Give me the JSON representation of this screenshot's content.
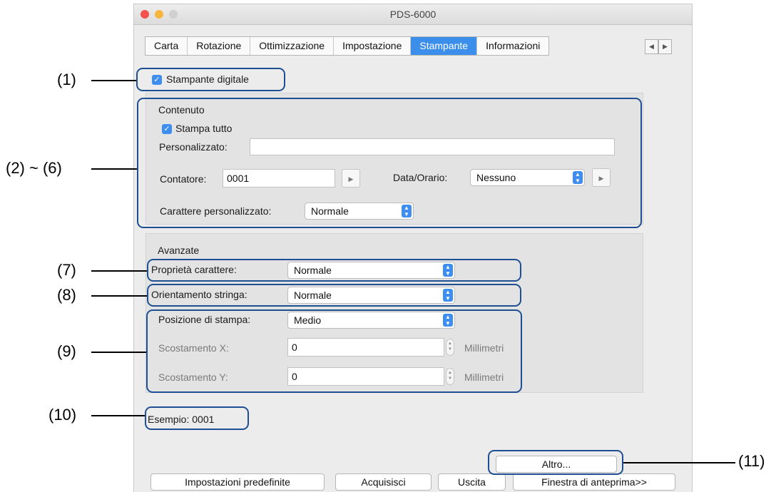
{
  "window": {
    "title": "PDS-6000"
  },
  "tabs": [
    {
      "label": "Carta",
      "active": false
    },
    {
      "label": "Rotazione",
      "active": false
    },
    {
      "label": "Ottimizzazione",
      "active": false
    },
    {
      "label": "Impostazione",
      "active": false
    },
    {
      "label": "Stampante",
      "active": true
    },
    {
      "label": "Informazioni",
      "active": false
    }
  ],
  "tab_arrows": {
    "left": "◀",
    "right": "▶"
  },
  "digital_printer": {
    "label": "Stampante digitale",
    "checked": true
  },
  "contenuto": {
    "heading": "Contenuto",
    "print_all": {
      "label": "Stampa tutto",
      "checked": true
    },
    "custom_label": "Personalizzato:",
    "custom_value": "",
    "counter_label": "Contatore:",
    "counter_value": "0001",
    "datetime_label": "Data/Orario:",
    "datetime_value": "Nessuno",
    "custom_char_label": "Carattere personalizzato:",
    "custom_char_value": "Normale"
  },
  "avanzate": {
    "heading": "Avanzate",
    "char_property_label": "Proprietà carattere:",
    "char_property_value": "Normale",
    "string_orientation_label": "Orientamento stringa:",
    "string_orientation_value": "Normale",
    "print_position_label": "Posizione di stampa:",
    "print_position_value": "Medio",
    "offset_x_label": "Scostamento X:",
    "offset_x_value": "0",
    "offset_y_label": "Scostamento Y:",
    "offset_y_value": "0",
    "unit": "Millimetri"
  },
  "example": {
    "label": "Esempio:",
    "value": "0001"
  },
  "buttons": {
    "altro": "Altro...",
    "defaults": "Impostazioni predefinite",
    "acquire": "Acquisisci",
    "exit": "Uscita",
    "preview": "Finestra di anteprima>>"
  },
  "callouts": {
    "c1": "(1)",
    "c2_6": "(2) ~ (6)",
    "c7": "(7)",
    "c8": "(8)",
    "c9": "(9)",
    "c10": "(10)",
    "c11": "(11)"
  },
  "colors": {
    "accent": "#3b8eea",
    "callout": "#1e4f92",
    "window_bg": "#ececec"
  }
}
